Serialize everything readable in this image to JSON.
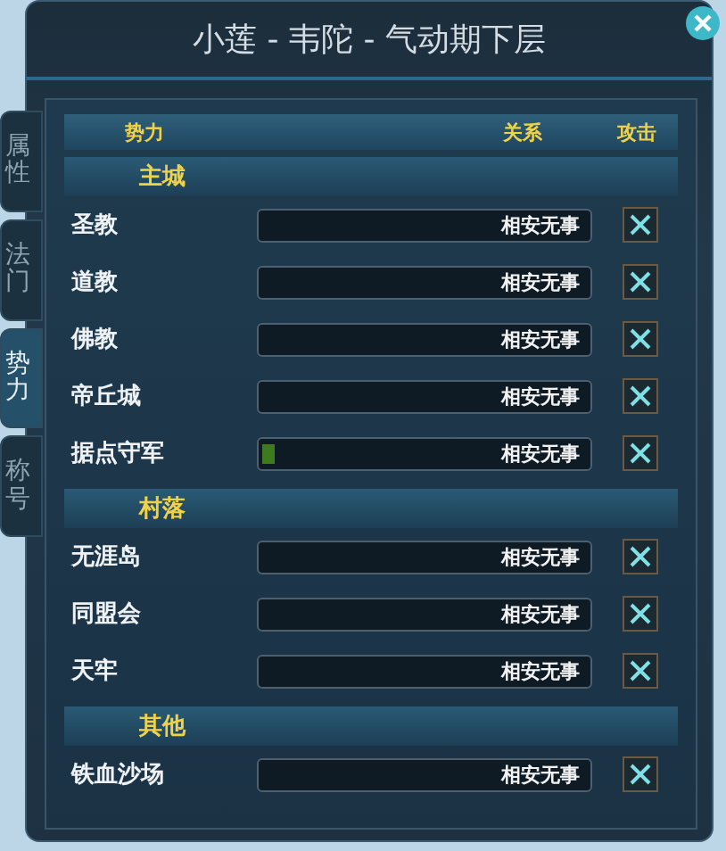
{
  "window": {
    "title": "小莲 - 韦陀 - 气动期下层"
  },
  "side_tabs": [
    {
      "label": "属性",
      "selected": false
    },
    {
      "label": "法门",
      "selected": false
    },
    {
      "label": "势力",
      "selected": true
    },
    {
      "label": "称号",
      "selected": false
    }
  ],
  "columns": [
    "势力",
    "关系",
    "攻击"
  ],
  "sections": [
    {
      "title": "主城",
      "rows": [
        {
          "name": "圣教",
          "relation": "相安无事",
          "checked": true
        },
        {
          "name": "道教",
          "relation": "相安无事",
          "checked": true
        },
        {
          "name": "佛教",
          "relation": "相安无事",
          "checked": true
        },
        {
          "name": "帝丘城",
          "relation": "相安无事",
          "checked": true
        },
        {
          "name": "据点守军",
          "relation": "相安无事",
          "level": 0.04,
          "checked": true
        }
      ]
    },
    {
      "title": "村落",
      "rows": [
        {
          "name": "无涯岛",
          "relation": "相安无事",
          "checked": true
        },
        {
          "name": "同盟会",
          "relation": "相安无事",
          "checked": true
        },
        {
          "name": "天牢",
          "relation": "相安无事",
          "checked": true
        }
      ]
    },
    {
      "title": "其他",
      "rows": [
        {
          "name": "铁血沙场",
          "relation": "相安无事",
          "checked": true
        }
      ]
    }
  ]
}
